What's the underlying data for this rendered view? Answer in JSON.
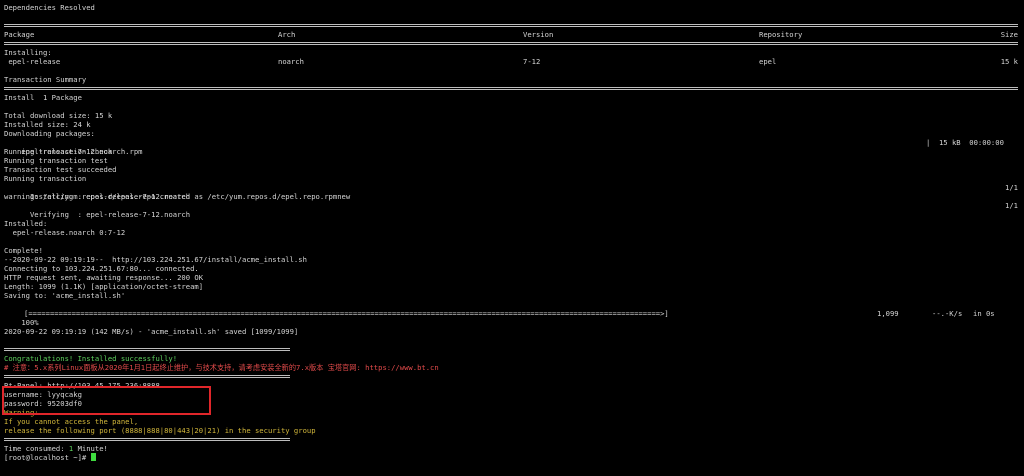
{
  "lines": {
    "deps": "Dependencies Resolved",
    "installing": "Installing:",
    "summary": "Transaction Summary",
    "install_count": "Install  1 Package",
    "total_dl": "Total download size: 15 k",
    "installed_size": "Installed size: 24 k",
    "downloading": "Downloading packages:",
    "check": "Running transaction check",
    "test": "Running transaction test",
    "test_ok": "Transaction test succeeded",
    "running": "Running transaction",
    "installing_pkg": "  Installing : epel-release-7-12.noarch",
    "warning_repo": "warning: /etc/yum.repos.d/epel.repo created as /etc/yum.repos.d/epel.repo.rpmnew",
    "verifying_pkg": "  Verifying  : epel-release-7-12.noarch",
    "installed": "Installed:",
    "installed_pkg": "  epel-release.noarch 0:7-12",
    "complete": "Complete!",
    "wget": "--2020-09-22 09:19:19--  http://103.224.251.67/install/acme_install.sh",
    "connecting": "Connecting to 103.224.251.67:80... connected.",
    "http": "HTTP request sent, awaiting response... 200 OK",
    "length": "Length: 1099 (1.1K) [application/octet-stream]",
    "saving": "Saving to: 'acme_install.sh'",
    "saved": "2020-09-22 09:19:19 (142 MB/s) - 'acme_install.sh' saved [1099/1099]",
    "congrats": "Congratulations! Installed successfully!",
    "notice": "# 注意：5.x系列Linux面板从2020年1月1日起终止维护，与技术支持，请考虑安装全新的7.x版本 宝塔官网: https://www.bt.cn",
    "panel": "Bt-Panel: http://103.45.175.236:8888",
    "username": "username: lyyqcakg",
    "password": "password: 95203df0",
    "warn1": "Warning:",
    "warn2": "If you cannot access the panel,",
    "warn3": "release the following port (8888|888|80|443|20|21) in the security group",
    "time_label": "Time consumed: ",
    "time_value": "1",
    "time_unit": " Minute!",
    "prompt": "[root@localhost ~]# "
  },
  "table": {
    "headers": {
      "package": "Package",
      "arch": "Arch",
      "version": "Version",
      "repository": "Repository",
      "size": "Size"
    },
    "row": {
      "package": " epel-release",
      "arch": "noarch",
      "version": "7-12",
      "repository": "epel",
      "size": "15 k"
    }
  },
  "download": {
    "file": "epel-release-7-12.noarch.rpm",
    "stat": "|  15 kB  00:00:00"
  },
  "counters": {
    "install": "1/1",
    "verify": "1/1"
  },
  "progress": {
    "percent_label": "100%",
    "bar": "[==================================================================================================================================================>]",
    "bytes": "1,099",
    "speed": "--.-K/s",
    "eta": "in 0s",
    "fraction": 1.0
  },
  "colors": {
    "background": "#000000",
    "text": "#d6d6d6",
    "success": "#5fd35f",
    "notice": "#e34b4b",
    "warning": "#d2b73b",
    "highlight_box": "#e0262a",
    "cursor": "#3fdc3f"
  }
}
